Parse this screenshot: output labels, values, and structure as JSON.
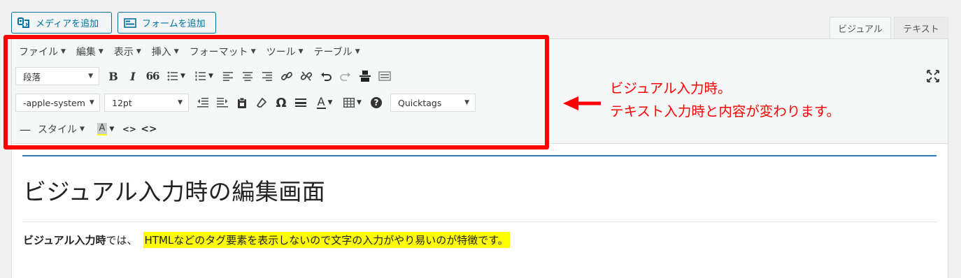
{
  "top_buttons": {
    "media_label": "メディアを追加",
    "form_label": "フォームを追加"
  },
  "mode_tabs": {
    "visual": "ビジュアル",
    "text": "テキスト"
  },
  "menubar": [
    {
      "label": "ファイル"
    },
    {
      "label": "編集"
    },
    {
      "label": "表示"
    },
    {
      "label": "挿入"
    },
    {
      "label": "フォーマット"
    },
    {
      "label": "ツール"
    },
    {
      "label": "テーブル"
    }
  ],
  "toolbar": {
    "paragraph_select": "段落",
    "font_family_select": "-apple-system",
    "font_size_select": "12pt",
    "quicktags_select": "Quicktags",
    "style_menu": "スタイル",
    "bold_glyph": "B",
    "italic_glyph": "I",
    "quote_glyph": "66",
    "omega_glyph": "Ω",
    "text_color_glyph": "A",
    "bg_color_glyph": "A",
    "help_glyph": "?",
    "hr_glyph": "—",
    "code_glyph": "<>",
    "code2_glyph": "<>"
  },
  "annotation": {
    "line1": "ビジュアル入力時。",
    "line2": "テキスト入力時と内容が変わります。",
    "color": "#ff0000"
  },
  "content": {
    "title": "ビジュアル入力時の編集画面",
    "para_strong": "ビジュアル入力時",
    "para_normal": "では、",
    "para_highlight": "HTMLなどのタグ要素を表示しないので文字の入力がやり易いのが特徴です。"
  },
  "colors": {
    "accent_blue": "#0071a1",
    "highlight": "#ffff00",
    "frame_red": "#ff0000"
  }
}
